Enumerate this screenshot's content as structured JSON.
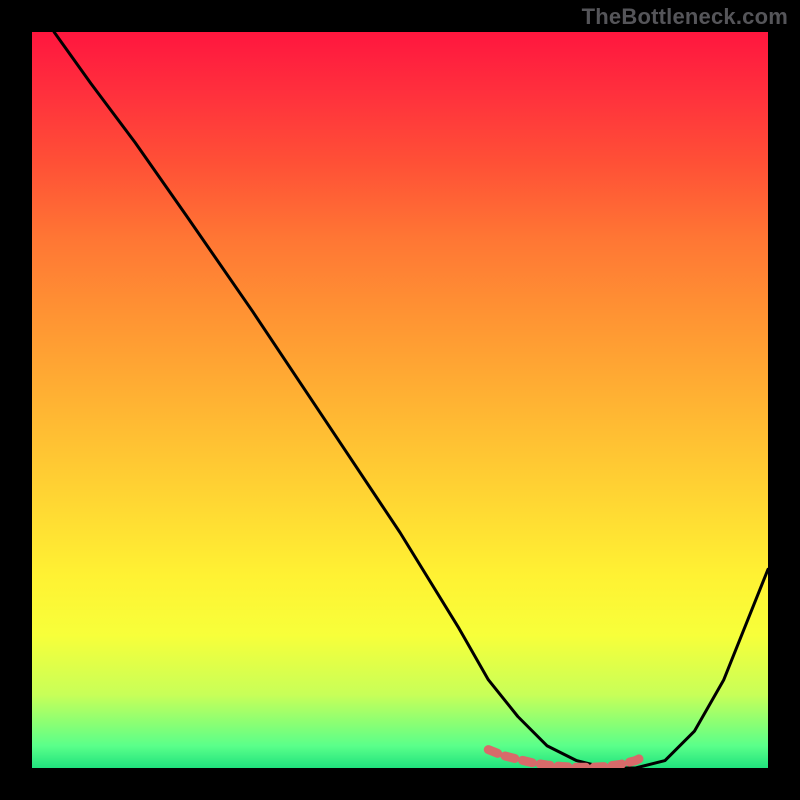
{
  "watermark": "TheBottleneck.com",
  "colors": {
    "background": "#000000",
    "curve_stroke": "#000000",
    "marker_stroke": "#d86a6a",
    "gradient_top": "#ff163e",
    "gradient_bottom": "#20e27d"
  },
  "chart_data": {
    "type": "line",
    "title": "",
    "xlabel": "",
    "ylabel": "",
    "xlim": [
      0,
      100
    ],
    "ylim": [
      0,
      100
    ],
    "annotations": [],
    "series": [
      {
        "name": "curve",
        "x": [
          3,
          8,
          14,
          21,
          30,
          40,
          50,
          58,
          62,
          66,
          70,
          74,
          78,
          82,
          86,
          90,
          94,
          100
        ],
        "y": [
          100,
          93,
          85,
          75,
          62,
          47,
          32,
          19,
          12,
          7,
          3,
          1,
          0,
          0,
          1,
          5,
          12,
          27
        ]
      },
      {
        "name": "highlight_markers",
        "x": [
          62,
          64,
          66,
          68,
          70,
          72,
          74,
          76,
          78,
          80,
          82,
          83
        ],
        "y": [
          2.5,
          1.7,
          1.2,
          0.7,
          0.4,
          0.2,
          0.1,
          0.1,
          0.2,
          0.5,
          1.0,
          1.5
        ]
      }
    ]
  }
}
